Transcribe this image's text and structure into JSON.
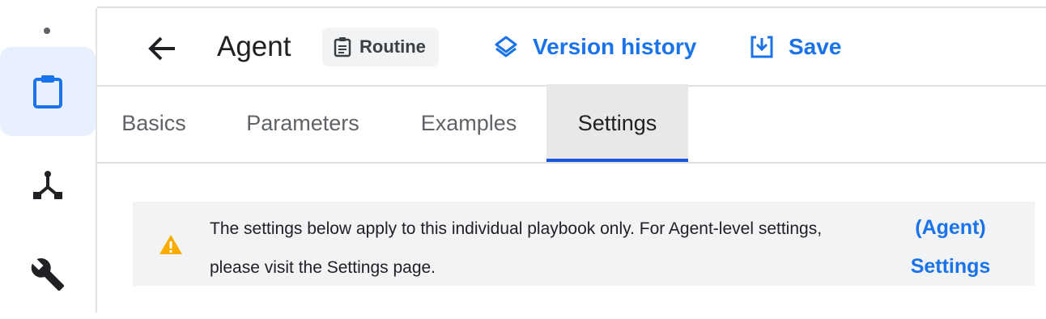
{
  "header": {
    "title": "Agent",
    "type_chip": "Routine",
    "version_history": "Version history",
    "save": "Save"
  },
  "tabs": [
    {
      "label": "Basics",
      "active": false
    },
    {
      "label": "Parameters",
      "active": false
    },
    {
      "label": "Examples",
      "active": false
    },
    {
      "label": "Settings",
      "active": true
    }
  ],
  "banner": {
    "message": "The settings below apply to this individual playbook only. For Agent-level settings, please visit the Settings page.",
    "link": "(Agent) Settings"
  },
  "sidebar": {
    "items": [
      {
        "icon": "clipboard-icon",
        "active": true
      },
      {
        "icon": "flow-icon",
        "active": false
      },
      {
        "icon": "wrench-icon",
        "active": false
      }
    ]
  },
  "colors": {
    "accent": "#1a73e8",
    "tab_indicator": "#1a56db",
    "warning": "#f9ab00",
    "active_bg": "#e8f0fe"
  }
}
